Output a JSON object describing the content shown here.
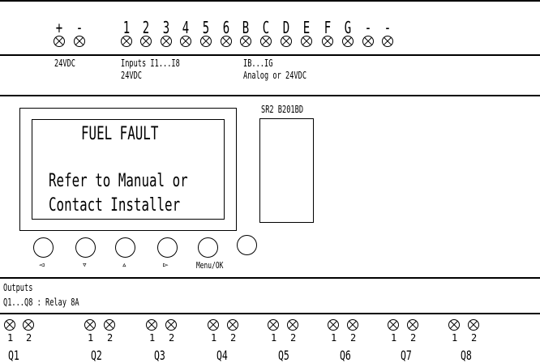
{
  "top_terminals": {
    "labels": [
      "+",
      "-",
      "1",
      "2",
      "3",
      "4",
      "5",
      "6",
      "B",
      "C",
      "D",
      "E",
      "F",
      "G",
      "-",
      "-"
    ]
  },
  "supply": {
    "label": "24VDC"
  },
  "inputs": {
    "line1": "Inputs I1...I8",
    "line2": "24VDC"
  },
  "analog": {
    "line1": "IB...IG",
    "line2": "Analog or 24VDC"
  },
  "model": {
    "label": "SR2 B201BD"
  },
  "display": {
    "title": "FUEL FAULT",
    "line1": "Refer to Manual or",
    "line2": "Contact Installer"
  },
  "buttons": {
    "left": "◅",
    "down": "▿",
    "up": "▵",
    "right": "▻",
    "menu": "Menu/OK"
  },
  "outputs": {
    "title": "Outputs",
    "desc": "Q1...Q8 : Relay 8A"
  },
  "relays": [
    {
      "label": "Q1",
      "t1": "1",
      "t2": "2"
    },
    {
      "label": "Q2",
      "t1": "1",
      "t2": "2"
    },
    {
      "label": "Q3",
      "t1": "1",
      "t2": "2"
    },
    {
      "label": "Q4",
      "t1": "1",
      "t2": "2"
    },
    {
      "label": "Q5",
      "t1": "1",
      "t2": "2"
    },
    {
      "label": "Q6",
      "t1": "1",
      "t2": "2"
    },
    {
      "label": "Q7",
      "t1": "1",
      "t2": "2"
    },
    {
      "label": "Q8",
      "t1": "1",
      "t2": "2"
    }
  ]
}
